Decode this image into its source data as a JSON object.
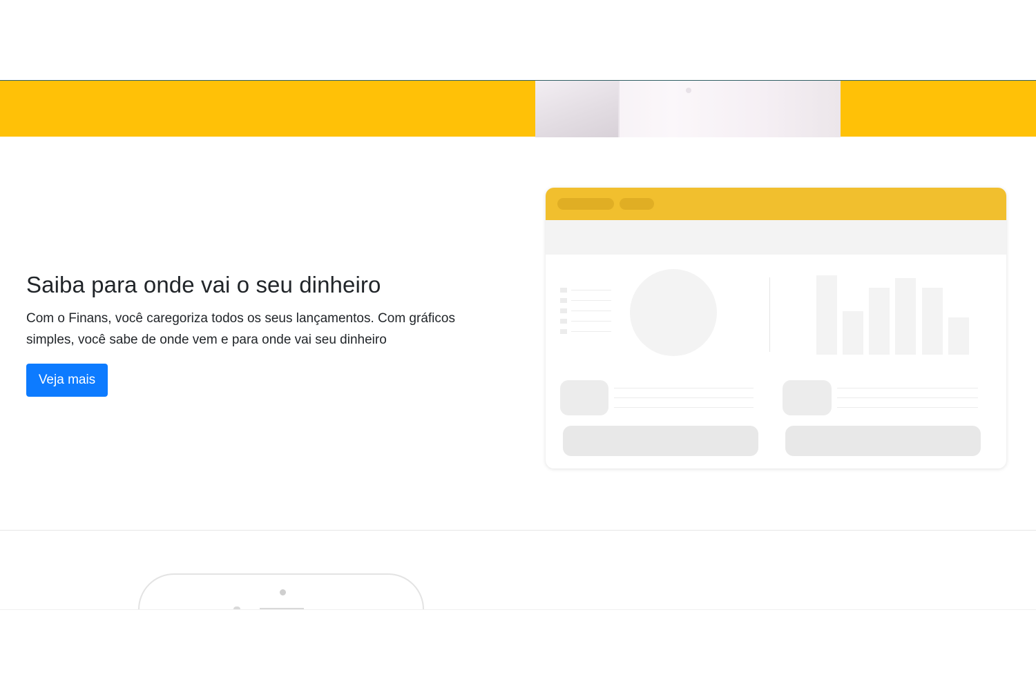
{
  "hero": {
    "band_color": "#ffc107"
  },
  "feature": {
    "title": "Saiba para onde vai o seu dinheiro",
    "description": "Com o Finans, você caregoriza todos os seus lançamentos. Com gráficos simples, você sabe de onde vem e para onde vai seu dinheiro",
    "cta_label": "Veja mais",
    "cta_color": "#0d7bff"
  },
  "illustration": {
    "header_color": "#f1bf2e",
    "icon": "dashboard-mockup-illustration"
  },
  "next_section": {
    "icon": "device-illustration"
  }
}
